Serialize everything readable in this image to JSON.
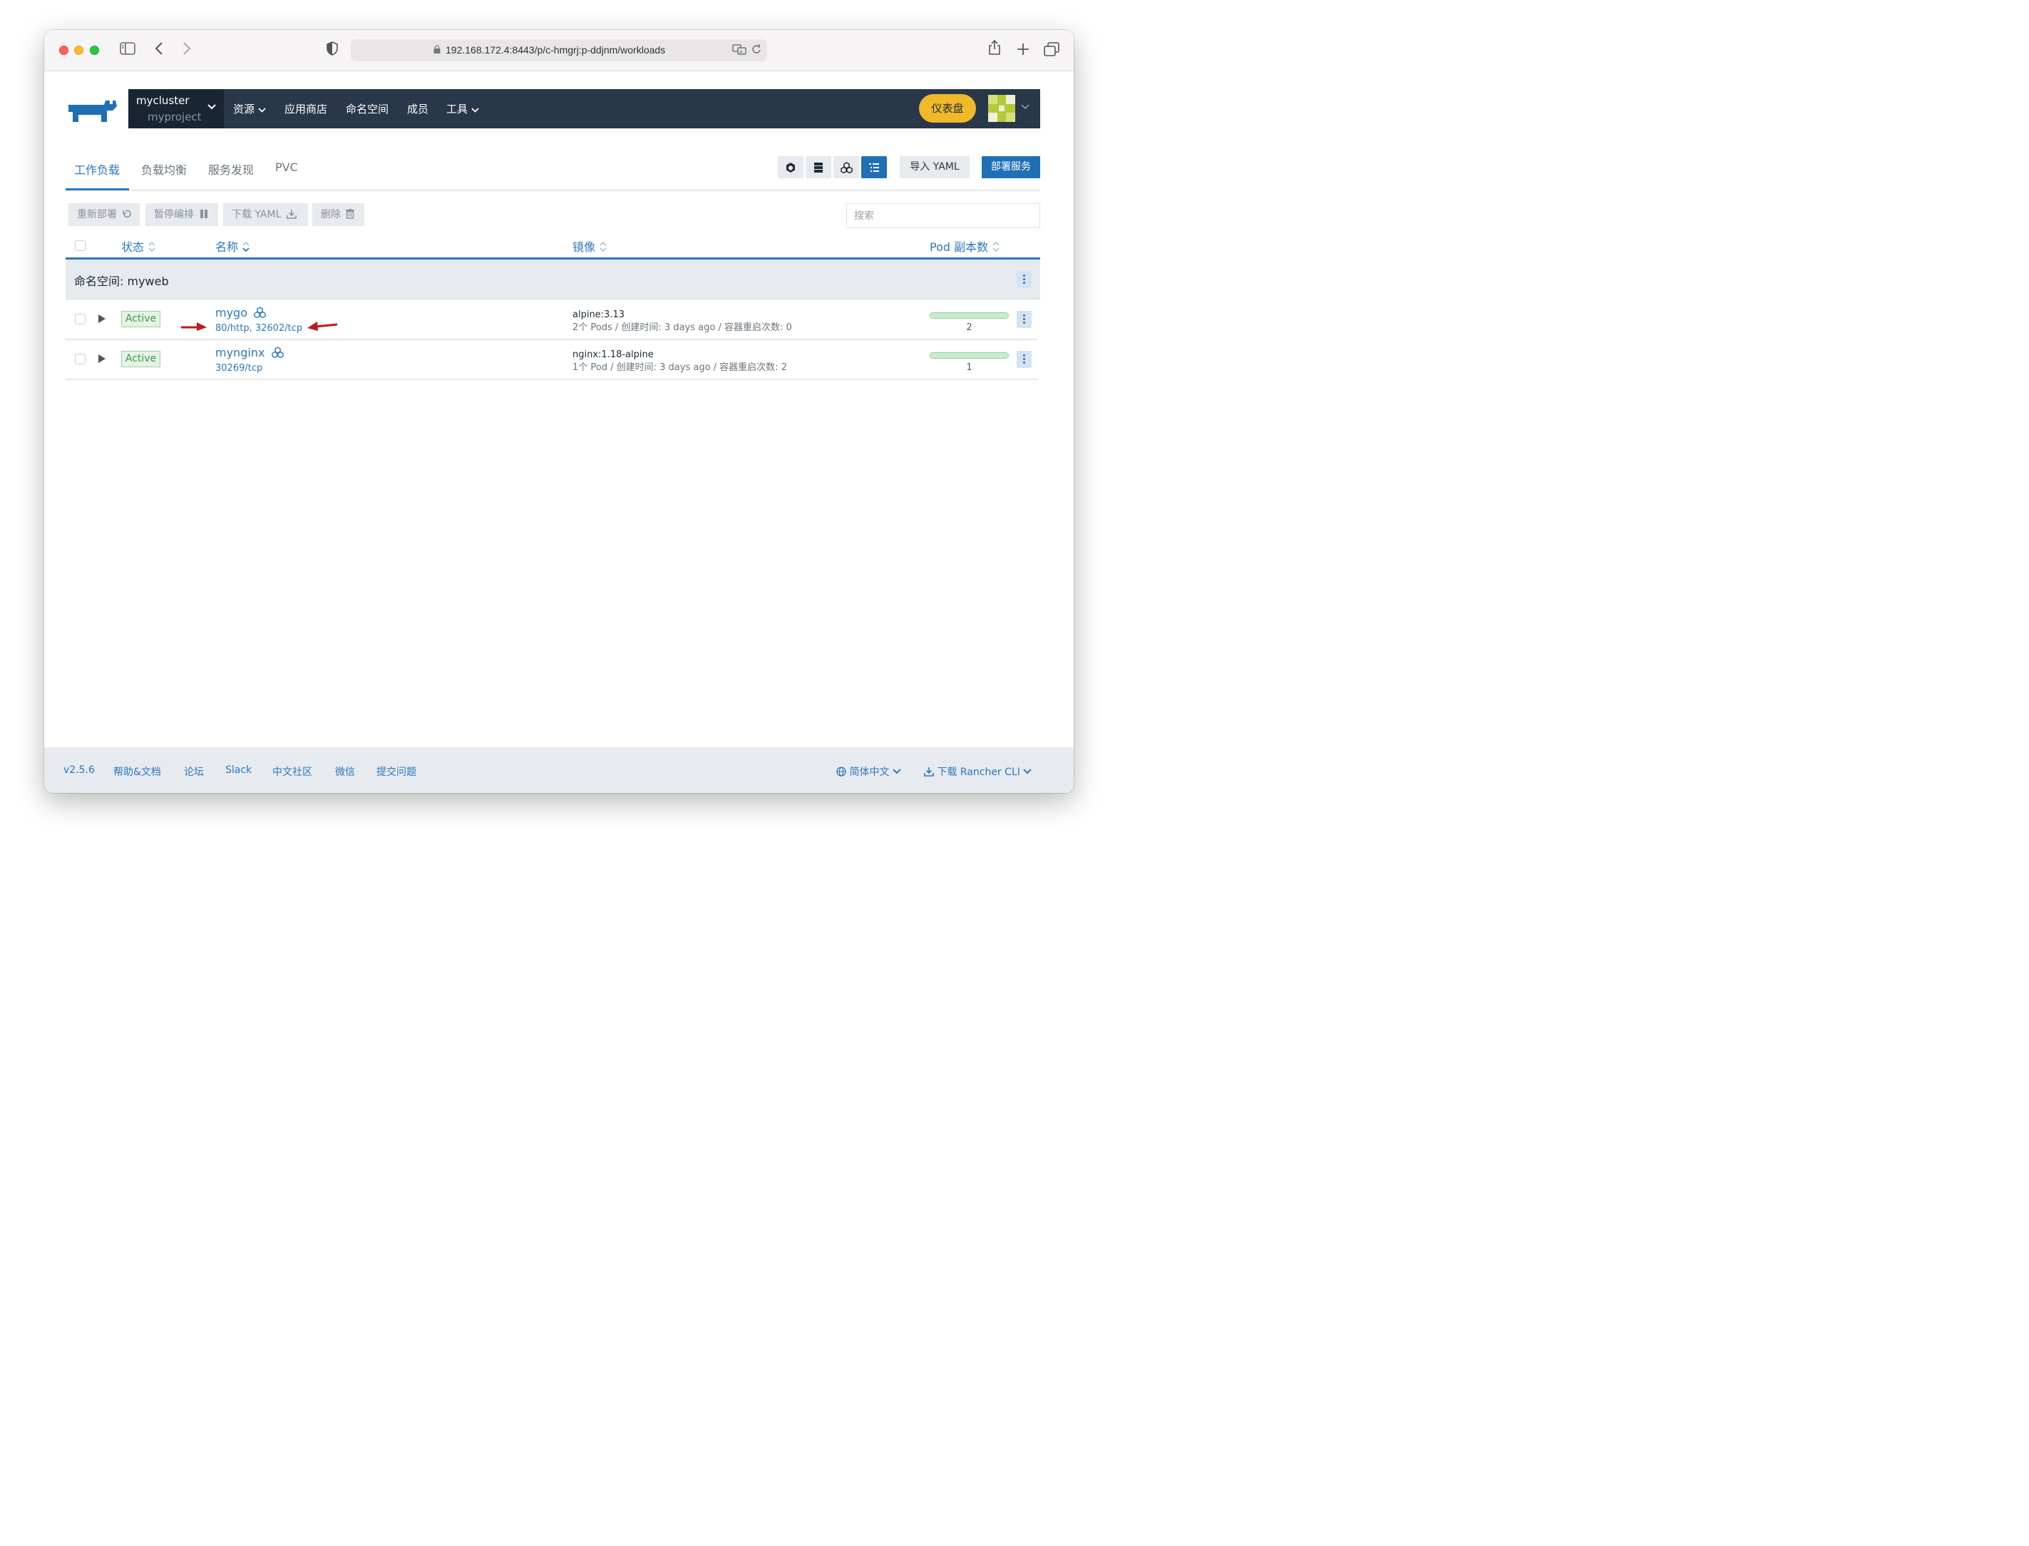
{
  "browser": {
    "url": "192.168.172.4:8443/p/c-hmgrj:p-ddjnm/workloads"
  },
  "header": {
    "cluster": "mycluster",
    "project": "myproject",
    "nav": [
      "资源",
      "应用商店",
      "命名空间",
      "成员",
      "工具"
    ],
    "dashboard_label": "仪表盘"
  },
  "tabs": [
    "工作负载",
    "负载均衡",
    "服务发现",
    "PVC"
  ],
  "actions": {
    "import_yaml": "导入 YAML",
    "deploy": "部署服务",
    "redeploy": "重新部署",
    "pause": "暂停编排",
    "download_yaml": "下载 YAML",
    "delete": "删除",
    "search_placeholder": "搜索"
  },
  "table": {
    "columns": [
      "状态",
      "名称",
      "镜像",
      "Pod 副本数"
    ],
    "group_label": "命名空间: myweb",
    "rows": [
      {
        "status": "Active",
        "name": "mygo",
        "ports": "80/http, 32602/tcp",
        "image": "alpine:3.13",
        "meta": "2个 Pods / 创建时间: 3 days ago / 容器重启次数: 0",
        "pods": "2"
      },
      {
        "status": "Active",
        "name": "mynginx",
        "ports": "30269/tcp",
        "image": "nginx:1.18-alpine",
        "meta": "1个 Pod / 创建时间: 3 days ago / 容器重启次数: 2",
        "pods": "1"
      }
    ]
  },
  "footer": {
    "version": "v2.5.6",
    "links": [
      "帮助&文档",
      "论坛",
      "Slack",
      "中文社区",
      "微信",
      "提交问题"
    ],
    "language": "简体中文",
    "cli": "下载 Rancher CLI"
  },
  "colors": {
    "accent": "#2b78bf",
    "navbar": "#28374a",
    "dashboard": "#f0b92a",
    "active": "#3c9a4c"
  }
}
